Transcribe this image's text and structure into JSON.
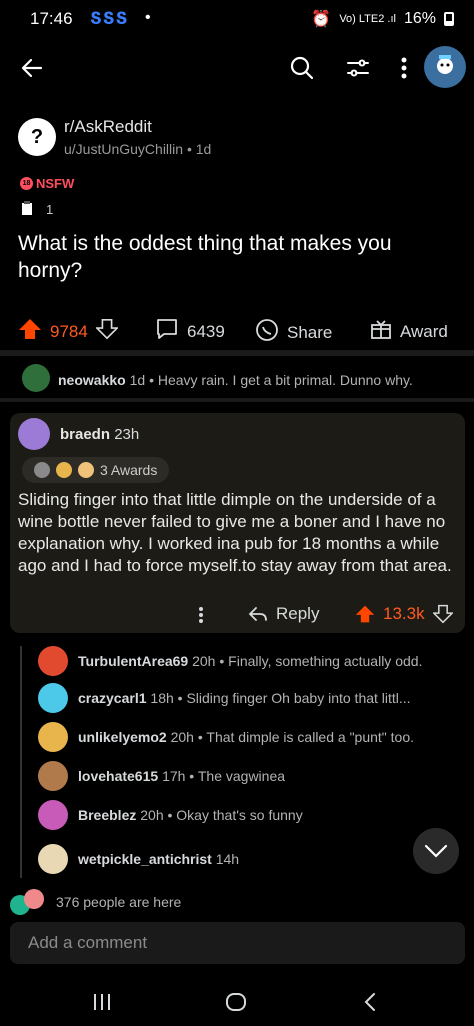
{
  "status_bar": {
    "time": "17:46",
    "notifications": "ՏՏՏ",
    "dot": "•",
    "right_text": "Vo) LTE2 .ıl",
    "battery": "16%"
  },
  "nav": {
    "back_icon": "back-arrow-icon",
    "search_icon": "search-icon",
    "filter_icon": "sort-filter-icon",
    "more_icon": "more-vertical-icon"
  },
  "post": {
    "subreddit": "r/AskReddit",
    "author": "u/JustUnGuyChillin",
    "age": "1d",
    "nsfw_label": "NSFW",
    "award_count": "1",
    "title": "What is the oddest thing that makes you horny?"
  },
  "actions": {
    "score": "9784",
    "comments": "6439",
    "share_label": "Share",
    "award_label": "Award"
  },
  "comments": {
    "top": {
      "username": "neowakko",
      "age": "1d",
      "text": "Heavy rain. I get a bit primal. Dunno why."
    },
    "highlighted": {
      "username": "braedn",
      "age": "23h",
      "awards": "3 Awards",
      "body": "Sliding finger into that little dimple on the underside of a wine bottle never failed to give me a boner and I have no explanation why. I worked ina  pub for 18 months a while ago and I had to force myself.to stay away from that area.",
      "reply_label": "Reply",
      "score": "13.3k"
    },
    "replies": [
      {
        "username": "TurbulentArea69",
        "age": "20h",
        "text": "Finally, something actually odd.",
        "color": "#e24a2f"
      },
      {
        "username": "crazycarl1",
        "age": "18h",
        "text": "Sliding finger  Oh baby  into that littl...",
        "color": "#4cc9e8"
      },
      {
        "username": "unlikelyemo2",
        "age": "20h",
        "text": "That dimple is called a \"punt\" too.",
        "color": "#e8b44c"
      },
      {
        "username": "lovehate615",
        "age": "17h",
        "text": "The vagwinea",
        "color": "#b07a4a"
      },
      {
        "username": "Breeblez",
        "age": "20h",
        "text": "Okay that's so funny",
        "color": "#c85ab8"
      },
      {
        "username": "wetpickle_antichrist",
        "age": "14h",
        "text": "",
        "color": "#e8d9b4"
      }
    ]
  },
  "presence": {
    "text": "376 people are here"
  },
  "composer": {
    "placeholder": "Add a comment"
  },
  "colors": {
    "upvote": "#ff4500",
    "nsfw": "#ff4f5e",
    "link_blue": "#3b7cff"
  }
}
